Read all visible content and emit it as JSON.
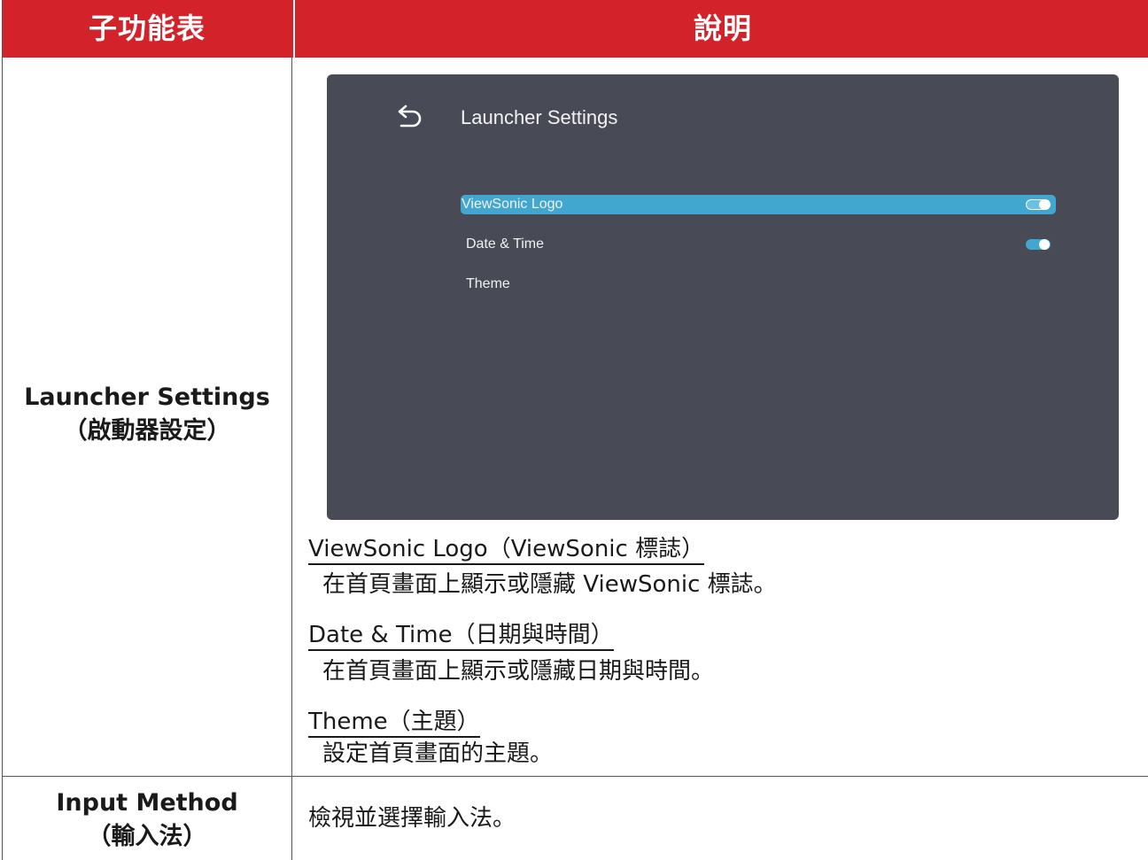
{
  "header": {
    "col1": "子功能表",
    "col2": "說明"
  },
  "rows": [
    {
      "sub_title": "Launcher Settings",
      "sub_title_cn": "（啟動器設定）",
      "screen": {
        "title": "Launcher Settings",
        "items": [
          {
            "label": "ViewSonic Logo",
            "toggle": true,
            "selected": true
          },
          {
            "label": "Date & Time",
            "toggle": true,
            "selected": false
          },
          {
            "label": "Theme"
          }
        ]
      },
      "options": [
        {
          "name": "ViewSonic Logo（ViewSonic 標誌）",
          "desc": "在首頁畫面上顯示或隱藏 ViewSonic 標誌。"
        },
        {
          "name": "Date & Time（日期與時間）",
          "desc": "在首頁畫面上顯示或隱藏日期與時間。"
        },
        {
          "name": "Theme（主題）",
          "desc": "設定首頁畫面的主題。"
        }
      ]
    },
    {
      "sub_title": "Input Method",
      "sub_title_cn": "（輸入法）",
      "desc": "檢視並選擇輸入法。"
    }
  ]
}
